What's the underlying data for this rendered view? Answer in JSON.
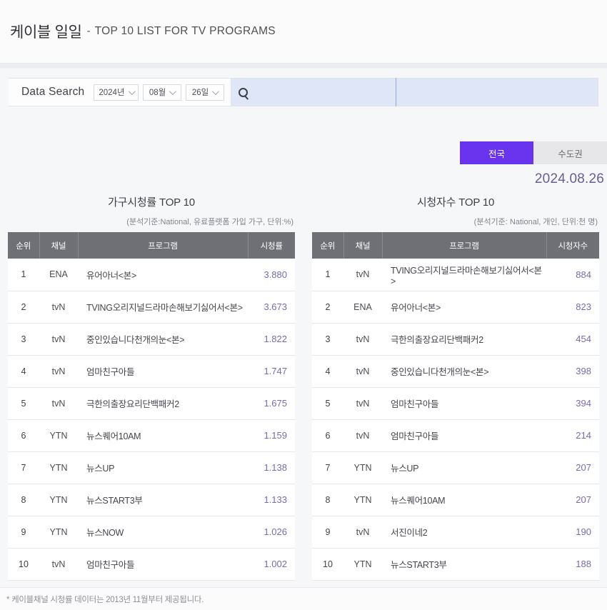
{
  "header": {
    "title_main": "케이블 일일",
    "title_dash": "-",
    "title_sub": "TOP 10 LIST FOR TV PROGRAMS"
  },
  "search": {
    "label": "Data Search",
    "year": "2024년",
    "month": "08월",
    "day": "26일",
    "search_icon": "search-icon",
    "query_value": "",
    "query_placeholder": ""
  },
  "tabs": {
    "national": "전국",
    "metro": "수도권",
    "active": "전국",
    "active_color": "#6a33ee",
    "inactive_color": "#e7e7ea"
  },
  "date_label": "2024.08.26",
  "footer": {
    "note": "* 케이블채널 시청률 데이터는 2013년 11월부터 제공됩니다."
  },
  "colors": {
    "value_purple": "#7a6aaf",
    "header_gray": "#6f7076",
    "date_purple": "#6a5d91"
  },
  "chart_data": [
    {
      "type": "table",
      "title": "가구시청률 TOP 10",
      "subtitle": "(분석기준:National, 유료플랫폼 가입 가구, 단위:%)",
      "columns": [
        "순위",
        "채널",
        "프로그램",
        "시청률"
      ],
      "unit": "%",
      "rows": [
        {
          "rank": "1",
          "channel": "ENA",
          "program": "유어아너<본>",
          "value": "3.880"
        },
        {
          "rank": "2",
          "channel": "tvN",
          "program": "TVING오리지널드라마손해보기싫어서<본>",
          "value": "3.673"
        },
        {
          "rank": "3",
          "channel": "tvN",
          "program": "중인있습니다천개의눈<본>",
          "value": "1.822"
        },
        {
          "rank": "4",
          "channel": "tvN",
          "program": "엄마친구아들",
          "value": "1.747"
        },
        {
          "rank": "5",
          "channel": "tvN",
          "program": "극한의출장요리단백패커2",
          "value": "1.675"
        },
        {
          "rank": "6",
          "channel": "YTN",
          "program": "뉴스퀘어10AM",
          "value": "1.159"
        },
        {
          "rank": "7",
          "channel": "YTN",
          "program": "뉴스UP",
          "value": "1.138"
        },
        {
          "rank": "8",
          "channel": "YTN",
          "program": "뉴스START3부",
          "value": "1.133"
        },
        {
          "rank": "9",
          "channel": "YTN",
          "program": "뉴스NOW",
          "value": "1.026"
        },
        {
          "rank": "10",
          "channel": "tvN",
          "program": "엄마친구아들",
          "value": "1.002"
        }
      ]
    },
    {
      "type": "table",
      "title": "시청자수 TOP 10",
      "subtitle": "(분석기준: National, 개인, 단위:천 명)",
      "columns": [
        "순위",
        "채널",
        "프로그램",
        "시청자수"
      ],
      "unit": "천 명",
      "rows": [
        {
          "rank": "1",
          "channel": "tvN",
          "program": "TVING오리지널드라마손해보기싫어서<본>",
          "value": "884"
        },
        {
          "rank": "2",
          "channel": "ENA",
          "program": "유어아너<본>",
          "value": "823"
        },
        {
          "rank": "3",
          "channel": "tvN",
          "program": "극한의출장요리단백패커2",
          "value": "454"
        },
        {
          "rank": "4",
          "channel": "tvN",
          "program": "중인있습니다천개의눈<본>",
          "value": "398"
        },
        {
          "rank": "5",
          "channel": "tvN",
          "program": "엄마친구아들",
          "value": "394"
        },
        {
          "rank": "6",
          "channel": "tvN",
          "program": "엄마친구아들",
          "value": "214"
        },
        {
          "rank": "7",
          "channel": "YTN",
          "program": "뉴스UP",
          "value": "207"
        },
        {
          "rank": "8",
          "channel": "YTN",
          "program": "뉴스퀘어10AM",
          "value": "207"
        },
        {
          "rank": "9",
          "channel": "tvN",
          "program": "서진이네2",
          "value": "190"
        },
        {
          "rank": "10",
          "channel": "YTN",
          "program": "뉴스START3부",
          "value": "188"
        }
      ]
    }
  ]
}
